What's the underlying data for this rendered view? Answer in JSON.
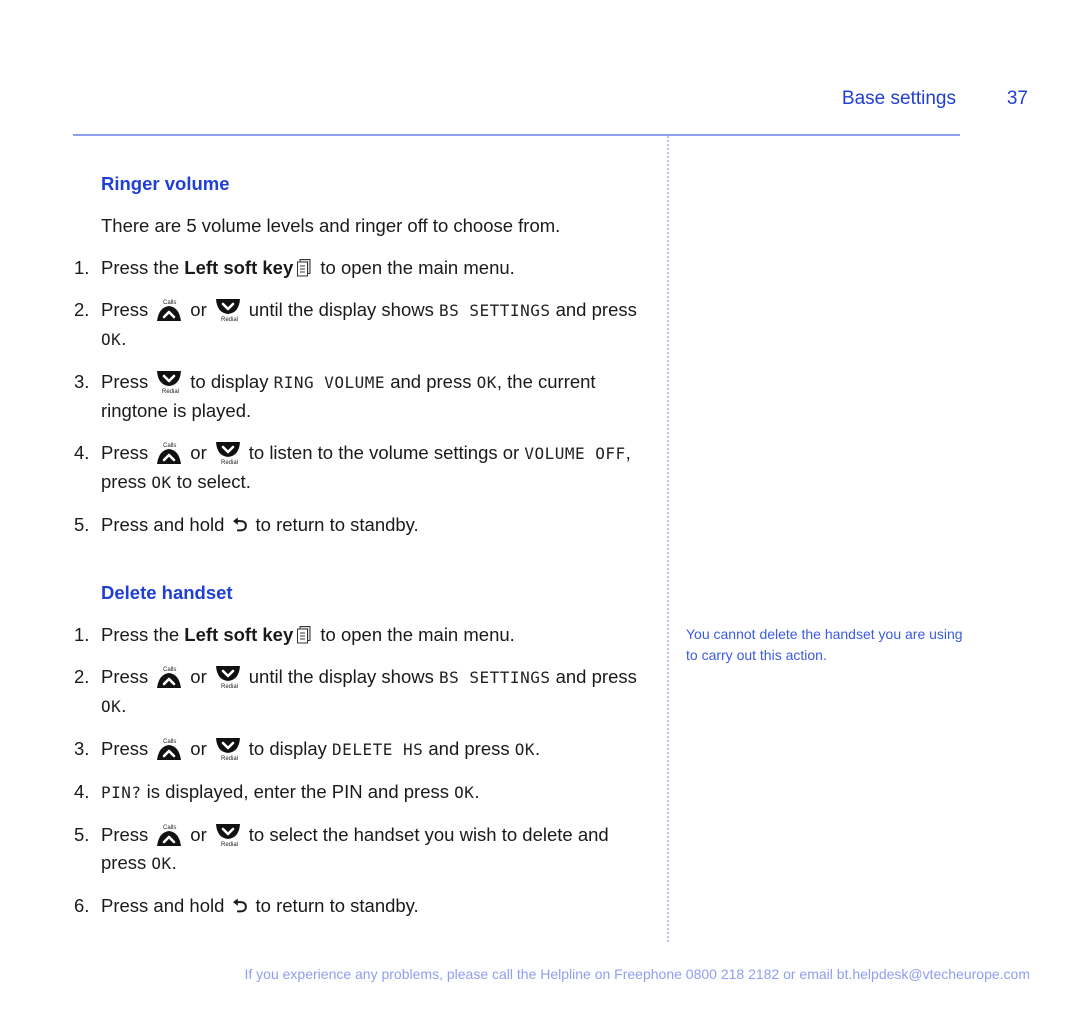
{
  "header": {
    "section": "Base settings",
    "page_number": "37"
  },
  "sections": [
    {
      "title": "Ringer volume",
      "intro": "There are 5 volume levels and ringer off to choose from.",
      "steps": [
        {
          "num": "1.",
          "parts": [
            "Press the ",
            "Left soft key",
            " to open the main menu."
          ]
        },
        {
          "num": "2.",
          "parts": [
            "Press",
            "or",
            "until the display shows ",
            "BS SETTINGS",
            " and press ",
            "OK",
            "."
          ]
        },
        {
          "num": "3.",
          "parts": [
            "Press",
            "to display ",
            "RING VOLUME",
            " and press ",
            "OK",
            ", the current ringtone is played."
          ]
        },
        {
          "num": "4.",
          "parts": [
            "Press",
            "or",
            "to listen to the volume settings or ",
            "VOLUME OFF",
            ",  press ",
            "OK",
            " to select."
          ]
        },
        {
          "num": "5.",
          "parts": [
            "Press and hold ",
            "to return to standby."
          ]
        }
      ]
    },
    {
      "title": "Delete handset",
      "steps": [
        {
          "num": "1.",
          "parts": [
            "Press the ",
            "Left soft key",
            " to open the main menu."
          ]
        },
        {
          "num": "2.",
          "parts": [
            "Press",
            "or",
            "until the display shows ",
            "BS SETTINGS",
            " and press ",
            "OK",
            "."
          ]
        },
        {
          "num": "3.",
          "parts": [
            "Press",
            "or",
            "to display ",
            "DELETE HS",
            " and press ",
            "OK",
            "."
          ]
        },
        {
          "num": "4.",
          "parts": [
            "PIN?",
            " is displayed, enter the PIN and press ",
            "OK",
            "."
          ]
        },
        {
          "num": "5.",
          "parts": [
            "Press",
            "or",
            "to select the handset you wish to delete and press ",
            "OK",
            "."
          ]
        },
        {
          "num": "6.",
          "parts": [
            "Press and hold ",
            "to return to standby."
          ]
        }
      ]
    }
  ],
  "icons": {
    "calls_label": "Calls",
    "redial_label": "Redial",
    "back_glyph": "⮌"
  },
  "side_note": "You cannot delete the handset you are using to carry out this action.",
  "footer": "If you experience any problems, please call the Helpline on Freephone 0800 218 2182 or email bt.helpdesk@vtecheurope.com",
  "colors": {
    "accent": "#1f3fd6",
    "rule": "#8fa0f0",
    "footer": "#8f9ef0"
  }
}
